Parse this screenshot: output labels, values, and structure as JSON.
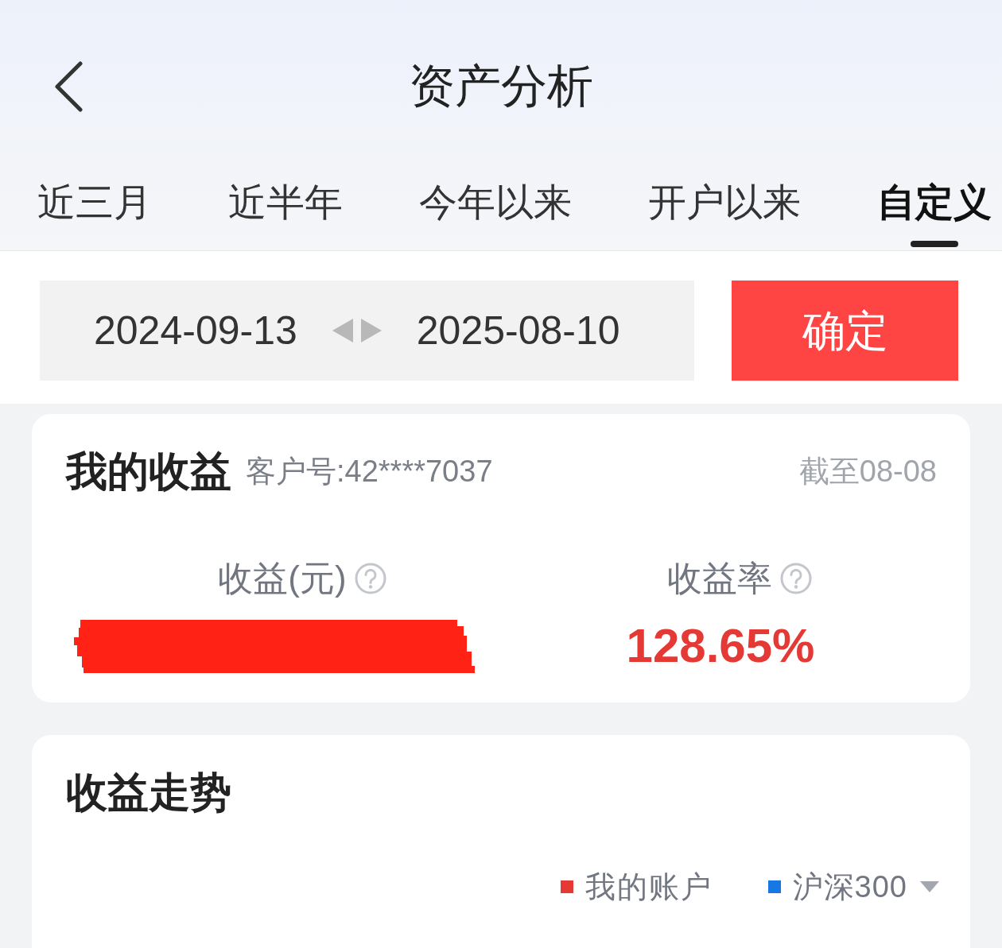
{
  "header": {
    "title": "资产分析"
  },
  "tabs": [
    {
      "label": "近三月",
      "selected": false
    },
    {
      "label": "近半年",
      "selected": false
    },
    {
      "label": "今年以来",
      "selected": false
    },
    {
      "label": "开户以来",
      "selected": false
    },
    {
      "label": "自定义",
      "selected": true
    }
  ],
  "date_range": {
    "start": "2024-09-13",
    "end": "2025-08-10",
    "confirm_button": "确定"
  },
  "earnings_card": {
    "title": "我的收益",
    "account": "客户号:42****7037",
    "as_of": "截至08-08",
    "metrics": [
      {
        "label": "收益(元)",
        "redacted": true
      },
      {
        "label": "收益率",
        "value": "128.65%",
        "redacted": false
      }
    ]
  },
  "trend_card": {
    "title": "收益走势",
    "legend": [
      {
        "label": "我的账户",
        "color": "#e53935",
        "dropdown": false
      },
      {
        "label": "沪深300",
        "color": "#1677e5",
        "dropdown": true
      }
    ]
  }
}
